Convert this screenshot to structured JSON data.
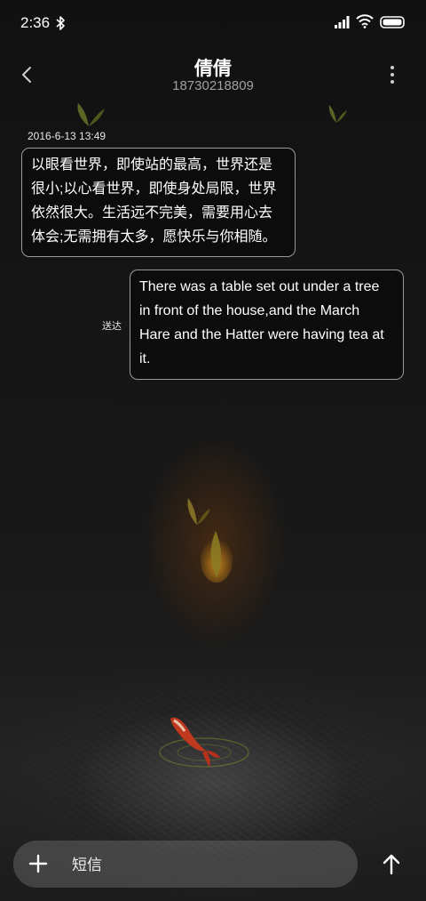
{
  "status_bar": {
    "time": "2:36",
    "icons": [
      "bluetooth-icon",
      "signal-icon",
      "wifi-icon",
      "battery-icon"
    ]
  },
  "header": {
    "title": "倩倩",
    "subtitle": "18730218809",
    "back_icon": "chevron-left-icon",
    "more_icon": "more-vertical-icon"
  },
  "messages": [
    {
      "direction": "incoming",
      "timestamp": "2016-6-13 13:49",
      "text": "以眼看世界，即使站的最高，世界还是很小;以心看世界，即使身处局限，世界依然很大。生活远不完美，需要用心去体会;无需拥有太多，愿快乐与你相随。"
    },
    {
      "direction": "outgoing",
      "status": "送达",
      "text": "There was a table set out under a tree in front of the house,and the March Hare and the Hatter were having tea at it."
    }
  ],
  "compose": {
    "placeholder": "短信",
    "value": "",
    "add_icon": "plus-icon",
    "send_icon": "arrow-up-icon"
  },
  "colors": {
    "background": "#141414",
    "bubble_border": "#9a9a9a",
    "subtitle": "#a0a0a0",
    "compose_bg": "#5c5c5c"
  }
}
